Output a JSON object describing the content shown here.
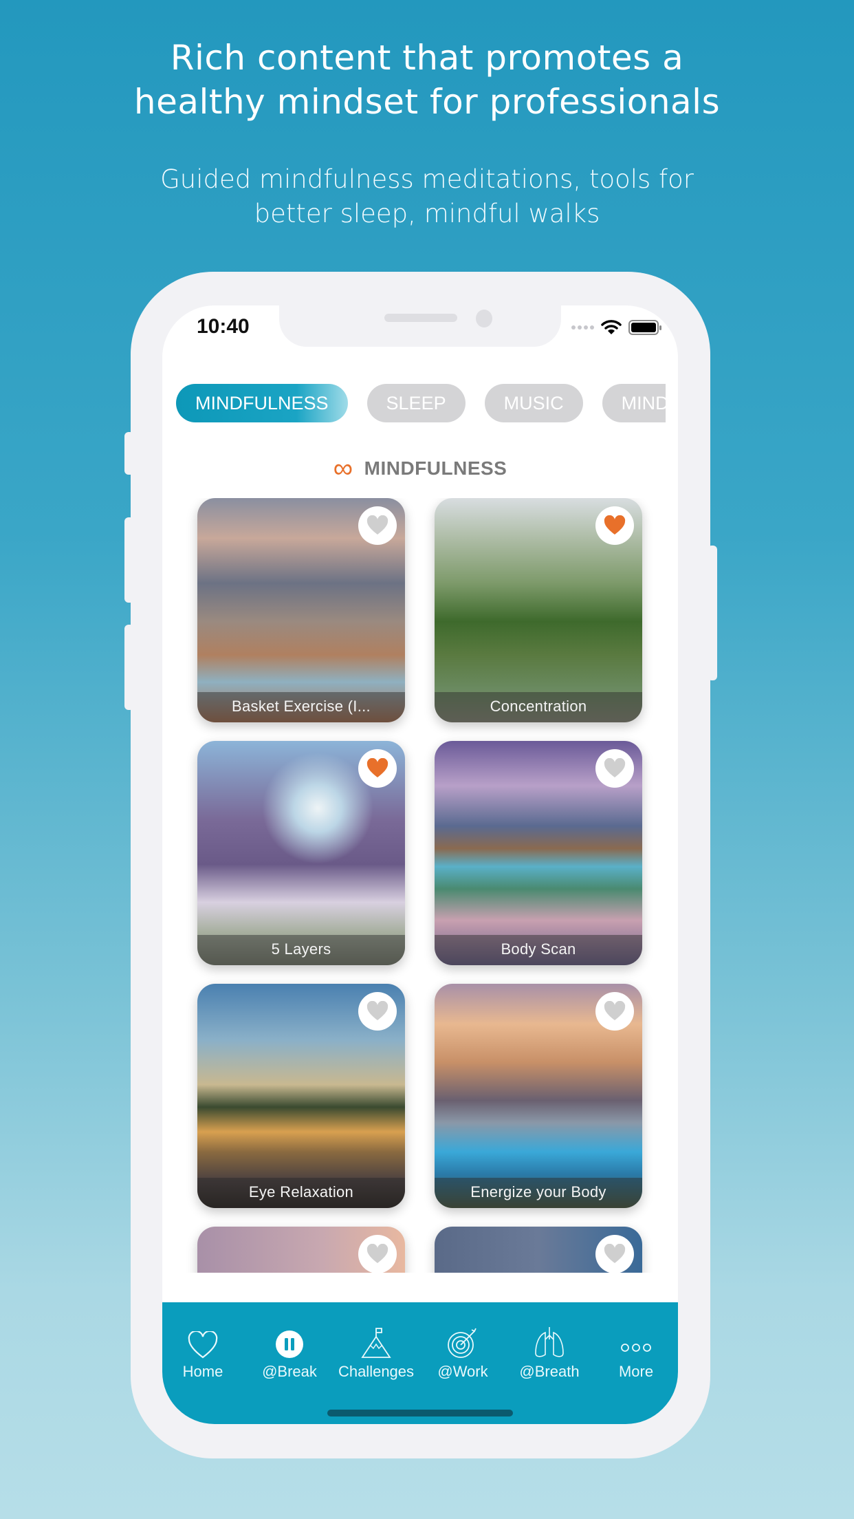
{
  "promo": {
    "headline_lines": [
      "Rich content that promotes a",
      "healthy mindset for professionals"
    ],
    "subline_lines": [
      "Guided mindfulness meditations, tools for",
      "better sleep, mindful walks"
    ]
  },
  "status_bar": {
    "time": "10:40",
    "signal_icon": "cellular-dots-icon",
    "wifi_icon": "wifi-icon",
    "battery_icon": "battery-icon"
  },
  "category_tabs": [
    {
      "label": "MINDFULNESS",
      "active": true
    },
    {
      "label": "SLEEP",
      "active": false
    },
    {
      "label": "MUSIC",
      "active": false
    },
    {
      "label": "MINDFUL WALKS",
      "active": false
    }
  ],
  "section": {
    "icon": "infinity-icon",
    "title": "MINDFULNESS"
  },
  "cards": [
    {
      "title": "Basket Exercise (I...",
      "favorite": false
    },
    {
      "title": "Concentration",
      "favorite": true
    },
    {
      "title": "5 Layers",
      "favorite": true
    },
    {
      "title": "Body Scan",
      "favorite": false
    },
    {
      "title": "Eye Relaxation",
      "favorite": false
    },
    {
      "title": "Energize your Body",
      "favorite": false
    },
    {
      "title": "",
      "favorite": false
    },
    {
      "title": "",
      "favorite": false
    }
  ],
  "tab_bar": [
    {
      "label": "Home",
      "icon": "heart-outline-icon"
    },
    {
      "label": "@Break",
      "icon": "pause-circle-icon",
      "active": true
    },
    {
      "label": "Challenges",
      "icon": "mountain-flag-icon"
    },
    {
      "label": "@Work",
      "icon": "target-icon"
    },
    {
      "label": "@Breath",
      "icon": "lungs-icon"
    },
    {
      "label": "More",
      "icon": "more-dots-icon"
    }
  ],
  "colors": {
    "accent": "#0a9dbd",
    "favorite": "#e8702a",
    "favorite_off": "#cfcfcf",
    "tab_inactive": "#d4d4d6"
  }
}
